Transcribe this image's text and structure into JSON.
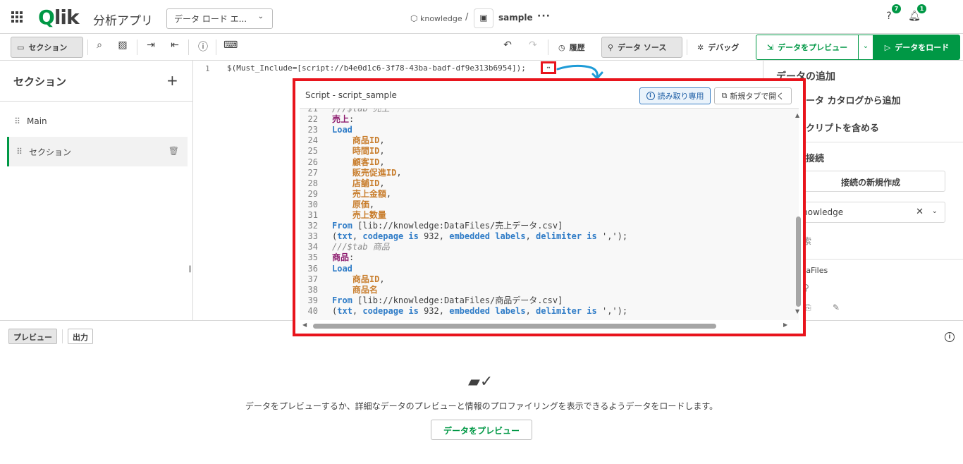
{
  "header": {
    "logo": "Qlik",
    "app_title": "分析アプリ",
    "view_select": "データ ロード エ...",
    "space": "knowledge",
    "separator": "/",
    "app_name": "sample",
    "more": "···",
    "help_badge": "7",
    "notif_badge": "1"
  },
  "toolbar": {
    "section_toggle": "セクション",
    "history": "履歴",
    "datasource": "データ ソース",
    "debug": "デバッグ",
    "preview": "データをプレビュー",
    "load": "データをロード"
  },
  "sidebar": {
    "title": "セクション",
    "items": [
      {
        "label": "Main"
      },
      {
        "label": "セクション"
      }
    ]
  },
  "editor": {
    "line_number": "1",
    "line_text": "$(Must_Include=[script://b4e0d1c6-3f78-43ba-badf-df9e313b6954]);",
    "fold_marker": "↔"
  },
  "right_panel": {
    "title": "データの追加",
    "catalog": "ータ カタログから追加",
    "include_script": "クリプトを含める",
    "connections": "接続",
    "new_connection": "接続の新規作成",
    "space_select": "nowledge",
    "search": "索",
    "datafiles": "taFiles"
  },
  "popup": {
    "title": "Script - script_sample",
    "readonly": "読み取り専用",
    "open_new_tab": "新規タブで開く",
    "lines": [
      {
        "n": "21",
        "t": [
          {
            "c": "cm",
            "s": "///$tab 売上"
          }
        ]
      },
      {
        "n": "22",
        "t": [
          {
            "c": "tbl",
            "s": "売上"
          },
          {
            "c": "tx",
            "s": ":"
          }
        ]
      },
      {
        "n": "23",
        "t": [
          {
            "c": "kw",
            "s": "Load"
          }
        ]
      },
      {
        "n": "24",
        "t": [
          {
            "c": "tx",
            "s": "    "
          },
          {
            "c": "fld",
            "s": "商品ID"
          },
          {
            "c": "tx",
            "s": ","
          }
        ]
      },
      {
        "n": "25",
        "t": [
          {
            "c": "tx",
            "s": "    "
          },
          {
            "c": "fld",
            "s": "時間ID"
          },
          {
            "c": "tx",
            "s": ","
          }
        ]
      },
      {
        "n": "26",
        "t": [
          {
            "c": "tx",
            "s": "    "
          },
          {
            "c": "fld",
            "s": "顧客ID"
          },
          {
            "c": "tx",
            "s": ","
          }
        ]
      },
      {
        "n": "27",
        "t": [
          {
            "c": "tx",
            "s": "    "
          },
          {
            "c": "fld",
            "s": "販売促進ID"
          },
          {
            "c": "tx",
            "s": ","
          }
        ]
      },
      {
        "n": "28",
        "t": [
          {
            "c": "tx",
            "s": "    "
          },
          {
            "c": "fld",
            "s": "店舗ID"
          },
          {
            "c": "tx",
            "s": ","
          }
        ]
      },
      {
        "n": "29",
        "t": [
          {
            "c": "tx",
            "s": "    "
          },
          {
            "c": "fld",
            "s": "売上金額"
          },
          {
            "c": "tx",
            "s": ","
          }
        ]
      },
      {
        "n": "30",
        "t": [
          {
            "c": "tx",
            "s": "    "
          },
          {
            "c": "fld",
            "s": "原価"
          },
          {
            "c": "tx",
            "s": ","
          }
        ]
      },
      {
        "n": "31",
        "t": [
          {
            "c": "tx",
            "s": "    "
          },
          {
            "c": "fld",
            "s": "売上数量"
          }
        ]
      },
      {
        "n": "32",
        "t": [
          {
            "c": "kw",
            "s": "From"
          },
          {
            "c": "tx",
            "s": " [lib://knowledge:DataFiles/売上データ.csv]"
          }
        ]
      },
      {
        "n": "33",
        "t": [
          {
            "c": "tx",
            "s": "("
          },
          {
            "c": "kw",
            "s": "txt"
          },
          {
            "c": "tx",
            "s": ", "
          },
          {
            "c": "kw",
            "s": "codepage is"
          },
          {
            "c": "tx",
            "s": " 932, "
          },
          {
            "c": "kw",
            "s": "embedded labels"
          },
          {
            "c": "tx",
            "s": ", "
          },
          {
            "c": "kw",
            "s": "delimiter is"
          },
          {
            "c": "tx",
            "s": " ',');"
          }
        ]
      },
      {
        "n": "34",
        "t": [
          {
            "c": "cm",
            "s": "///$tab 商品"
          }
        ]
      },
      {
        "n": "35",
        "t": [
          {
            "c": "tbl",
            "s": "商品"
          },
          {
            "c": "tx",
            "s": ":"
          }
        ]
      },
      {
        "n": "36",
        "t": [
          {
            "c": "kw",
            "s": "Load"
          }
        ]
      },
      {
        "n": "37",
        "t": [
          {
            "c": "tx",
            "s": "    "
          },
          {
            "c": "fld",
            "s": "商品ID"
          },
          {
            "c": "tx",
            "s": ","
          }
        ]
      },
      {
        "n": "38",
        "t": [
          {
            "c": "tx",
            "s": "    "
          },
          {
            "c": "fld",
            "s": "商品名"
          }
        ]
      },
      {
        "n": "39",
        "t": [
          {
            "c": "kw",
            "s": "From"
          },
          {
            "c": "tx",
            "s": " [lib://knowledge:DataFiles/商品データ.csv]"
          }
        ]
      },
      {
        "n": "40",
        "t": [
          {
            "c": "tx",
            "s": "("
          },
          {
            "c": "kw",
            "s": "txt"
          },
          {
            "c": "tx",
            "s": ", "
          },
          {
            "c": "kw",
            "s": "codepage is"
          },
          {
            "c": "tx",
            "s": " 932, "
          },
          {
            "c": "kw",
            "s": "embedded labels"
          },
          {
            "c": "tx",
            "s": ", "
          },
          {
            "c": "kw",
            "s": "delimiter is"
          },
          {
            "c": "tx",
            "s": " ',');"
          }
        ]
      }
    ]
  },
  "bottom": {
    "tab_preview": "プレビュー",
    "tab_output": "出力",
    "empty_text": "データをプレビューするか、詳細なデータのプレビューと情報のプロファイリングを表示できるようデータをロードします。",
    "empty_button": "データをプレビュー"
  },
  "colors": {
    "brand": "#009845",
    "highlight": "#e8141c",
    "annotation_arrow": "#1e9bd7"
  }
}
